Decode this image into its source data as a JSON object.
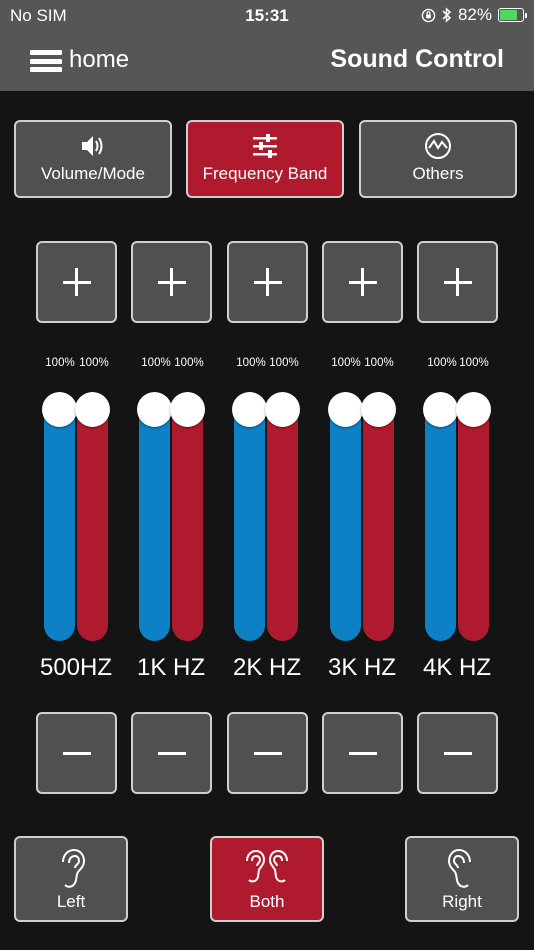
{
  "status": {
    "carrier": "No SIM",
    "time": "15:31",
    "battery": "82%",
    "battery_level": 0.82
  },
  "nav": {
    "home_label": "home",
    "title": "Sound Control"
  },
  "tabs": [
    {
      "label": "Volume/Mode",
      "icon": "speaker-icon",
      "active": false
    },
    {
      "label": "Frequency Band",
      "icon": "sliders-icon",
      "active": true
    },
    {
      "label": "Others",
      "icon": "waveform-circle-icon",
      "active": false
    }
  ],
  "bands": [
    {
      "label": "500HZ",
      "left_pct": "100%",
      "right_pct": "100%",
      "left_level": 1.0,
      "right_level": 1.0
    },
    {
      "label": "1K HZ",
      "left_pct": "100%",
      "right_pct": "100%",
      "left_level": 1.0,
      "right_level": 1.0
    },
    {
      "label": "2K HZ",
      "left_pct": "100%",
      "right_pct": "100%",
      "left_level": 1.0,
      "right_level": 1.0
    },
    {
      "label": "3K HZ",
      "left_pct": "100%",
      "right_pct": "100%",
      "left_level": 1.0,
      "right_level": 1.0
    },
    {
      "label": "4K HZ",
      "left_pct": "100%",
      "right_pct": "100%",
      "left_level": 1.0,
      "right_level": 1.0
    }
  ],
  "ears": [
    {
      "label": "Left",
      "icon": "ear-left-icon",
      "active": false
    },
    {
      "label": "Both",
      "icon": "ears-both-icon",
      "active": true
    },
    {
      "label": "Right",
      "icon": "ear-right-icon",
      "active": false
    }
  ],
  "colors": {
    "accent_red": "#b01a2e",
    "left_channel_blue": "#0d80c6",
    "button_gray": "#505050",
    "header_gray": "#565656",
    "background": "#141414"
  }
}
